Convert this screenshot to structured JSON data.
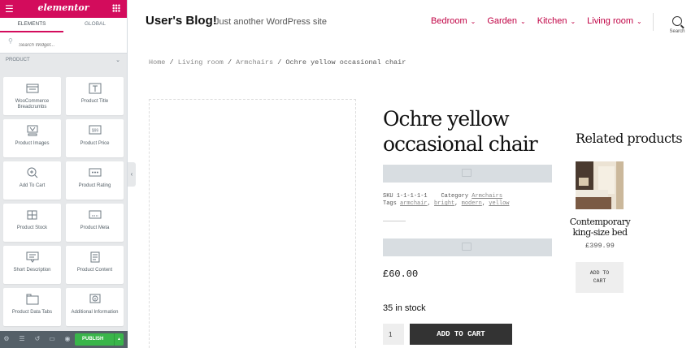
{
  "panel": {
    "brand": "elementor",
    "tabs": [
      "ELEMENTS",
      "GLOBAL"
    ],
    "search_placeholder": "Search Widget...",
    "category": "PRODUCT",
    "widgets": [
      {
        "label": "WooCommerce Breadcrumbs",
        "icon": "breadcrumbs-icon"
      },
      {
        "label": "Product Title",
        "icon": "title-icon"
      },
      {
        "label": "Product Images",
        "icon": "images-icon"
      },
      {
        "label": "Product Price",
        "icon": "price-icon"
      },
      {
        "label": "Add To Cart",
        "icon": "add-to-cart-icon"
      },
      {
        "label": "Product Rating",
        "icon": "rating-icon"
      },
      {
        "label": "Product Stock",
        "icon": "stock-icon"
      },
      {
        "label": "Product Meta",
        "icon": "meta-icon"
      },
      {
        "label": "Short Description",
        "icon": "short-description-icon"
      },
      {
        "label": "Product Content",
        "icon": "content-icon"
      },
      {
        "label": "Product Data Tabs",
        "icon": "data-tabs-icon"
      },
      {
        "label": "Additional Information",
        "icon": "info-icon"
      }
    ],
    "publish_label": "PUBLISH",
    "accent_color": "#d30c5c",
    "publish_color": "#39b54a"
  },
  "site": {
    "title": "User's Blog!",
    "description": "Just another WordPress site",
    "nav": [
      "Bedroom",
      "Garden",
      "Kitchen",
      "Living room"
    ],
    "search_label": "Search",
    "link_color": "#c00043"
  },
  "breadcrumb": {
    "home": "Home",
    "sep": "/",
    "level1": "Living room",
    "level2": "Armchairs",
    "current": "Ochre yellow occasional chair"
  },
  "product": {
    "title": "Ochre yellow occasional chair",
    "sku_label": "SKU",
    "sku": "1-1-1-1-1",
    "category_label": "Category",
    "category": "Armchairs",
    "tags_label": "Tags",
    "tags": [
      "armchair",
      "bright",
      "modern",
      "yellow"
    ],
    "price": "£60.00",
    "stock": "35 in stock",
    "quantity": "1",
    "add_to_cart": "ADD TO CART"
  },
  "related": {
    "title": "Related products",
    "item_name": "Contemporary king-size bed",
    "item_price": "£399.99",
    "item_cart_line1": "ADD TO",
    "item_cart_line2": "CART"
  }
}
